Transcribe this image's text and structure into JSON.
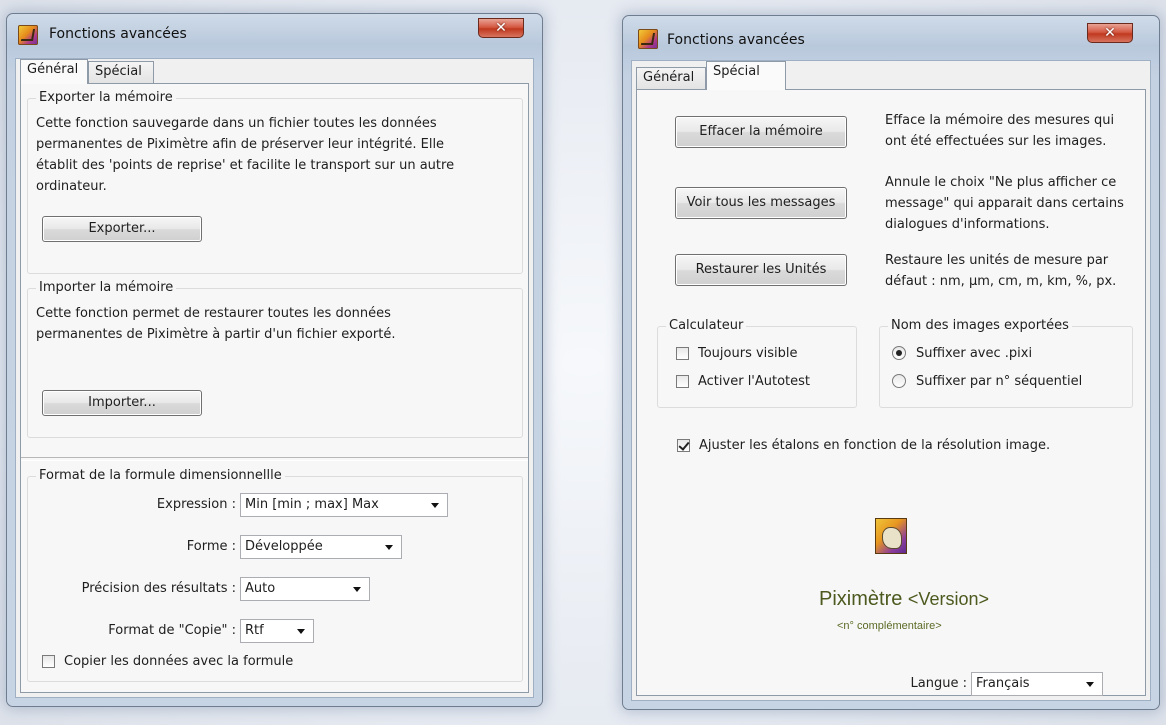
{
  "left_window": {
    "title": "Fonctions avancées",
    "close_glyph": "✕",
    "tabs": [
      "Général",
      "Spécial"
    ],
    "export_group": {
      "label": "Exporter la mémoire",
      "lines": [
        "Cette fonction sauvegarde dans un fichier toutes les données",
        "permanentes de Piximètre afin de préserver leur intégrité. Elle",
        "établit des 'points de reprise' et facilite le transport sur un autre",
        "ordinateur."
      ],
      "button": "Exporter..."
    },
    "import_group": {
      "label": "Importer la mémoire",
      "lines": [
        "Cette fonction permet de restaurer toutes les données",
        "permanentes de Piximètre à partir d'un fichier exporté."
      ],
      "button": "Importer..."
    },
    "format_group": {
      "label": "Format de la formule dimensionnellle",
      "expression_label": "Expression :",
      "expression_value": "Min [min ; max] Max",
      "forme_label": "Forme :",
      "forme_value": "Développée",
      "precision_label": "Précision des résultats :",
      "precision_value": "Auto",
      "copie_label": "Format de \"Copie\" :",
      "copie_value": "Rtf",
      "copy_checkbox": "Copier les données avec la formule"
    }
  },
  "right_window": {
    "title": "Fonctions avancées",
    "close_glyph": "✕",
    "tabs": [
      "Général",
      "Spécial"
    ],
    "actions": [
      {
        "button": "Effacer la mémoire",
        "desc": [
          "Efface la mémoire des mesures qui",
          "ont été effectuées sur les images."
        ]
      },
      {
        "button": "Voir tous les messages",
        "desc": [
          "Annule le choix \"Ne plus afficher ce",
          "message\" qui apparait dans certains",
          "dialogues d'informations."
        ]
      },
      {
        "button": "Restaurer les Unités",
        "desc": [
          "Restaure les unités de mesure par",
          "défaut : nm, µm, cm, m, km, %, px."
        ]
      }
    ],
    "calculateur": {
      "label": "Calculateur",
      "toujours_visible": "Toujours visible",
      "activer_autotest": "Activer l'Autotest"
    },
    "nom_images": {
      "label": "Nom des images exportées",
      "opt_pixi": "Suffixer avec .pixi",
      "opt_seq": "Suffixer par n° séquentiel",
      "selected": "Suffixer avec .pixi"
    },
    "ajuster": "Ajuster les étalons en fonction de la résolution image.",
    "ajuster_checked": true,
    "brand": "Piximètre",
    "version": "<Version>",
    "complement": "<n° complémentaire>",
    "langue_label": "Langue :",
    "langue_value": "Français"
  }
}
